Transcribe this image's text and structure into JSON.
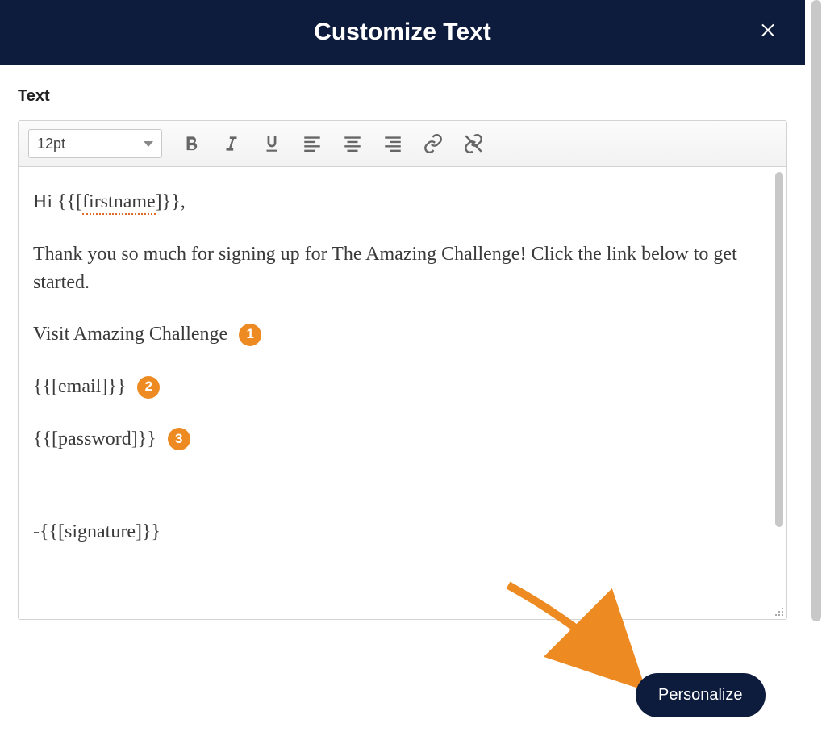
{
  "modal": {
    "title": "Customize Text",
    "close_icon": "close-icon"
  },
  "field": {
    "label": "Text"
  },
  "toolbar": {
    "font_size": "12pt",
    "bold_icon": "bold-icon",
    "italic_icon": "italic-icon",
    "underline_icon": "underline-icon",
    "align_left_icon": "align-left-icon",
    "align_center_icon": "align-center-icon",
    "align_right_icon": "align-right-icon",
    "link_icon": "link-icon",
    "unlink_icon": "unlink-icon"
  },
  "content": {
    "greeting_prefix": "Hi {{[",
    "greeting_token": "firstname",
    "greeting_suffix": "]}},",
    "paragraph": "Thank you so much for signing up for The Amazing Challenge! Click the link below to get started.",
    "line1_text": "Visit Amazing Challenge",
    "line2_text": "{{[email]}}",
    "line3_text": "{{[password]}}",
    "signature": "-{{[signature]}}"
  },
  "badges": {
    "b1": "1",
    "b2": "2",
    "b3": "3"
  },
  "buttons": {
    "personalize": "Personalize"
  }
}
